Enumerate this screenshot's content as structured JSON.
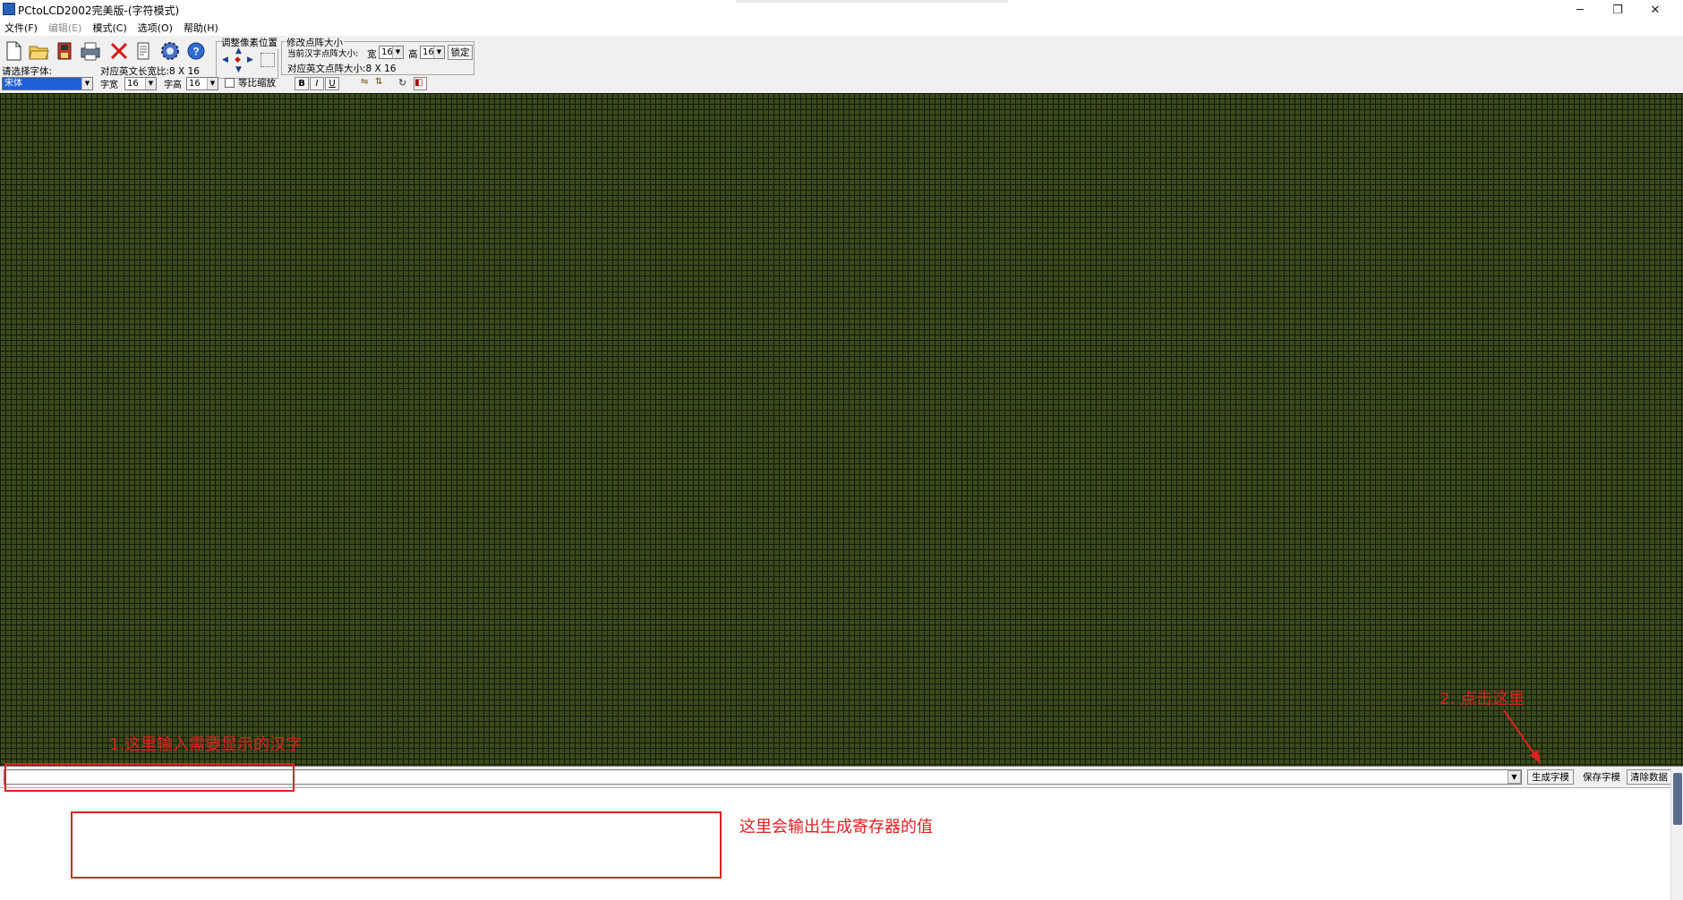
{
  "window": {
    "title": "PCtoLCD2002完美版-(字符模式)",
    "minimize": "─",
    "restore": "❐",
    "close": "✕"
  },
  "menu": [
    {
      "label": "文件(F)",
      "enabled": true
    },
    {
      "label": "编辑(E)",
      "enabled": false
    },
    {
      "label": "模式(C)",
      "enabled": true
    },
    {
      "label": "选项(O)",
      "enabled": true
    },
    {
      "label": "帮助(H)",
      "enabled": true
    }
  ],
  "toolbar": {
    "icons": [
      "new-file-icon",
      "open-folder-icon",
      "save-icon",
      "print-icon",
      "delete-icon",
      "properties-icon",
      "settings-gear-icon",
      "help-icon"
    ],
    "font_label": "请选择字体:",
    "font_value": "宋体",
    "en_ratio_label": "对应英文长宽比:8 X 16",
    "char_width_label": "字宽",
    "char_width_value": "16",
    "char_height_label": "字高",
    "char_height_value": "16",
    "proportional_label": "等比缩放",
    "bold": "B",
    "italic": "I",
    "underline": "U",
    "pixel_group_label": "调整像素位置",
    "matrix_group_label": "修改点阵大小",
    "current_matrix_label": "当前汉字点阵大小:",
    "width_label": "宽",
    "width_value": "16",
    "height_label": "高",
    "height_value": "16",
    "lock_label": "锁定",
    "en_matrix_label": "对应英文点阵大小:8 X 16"
  },
  "bottom": {
    "input_value": "",
    "generate_button": "生成字模",
    "save_button": "保存字模",
    "clear_button": "清除数据"
  },
  "annotations": {
    "step1": "1.这里输入需要显示的汉字",
    "step2": "2. 点击这里",
    "output_note": "这里会输出生成寄存器的值"
  },
  "colors": {
    "matrix_background": "#3a4a1c",
    "annotation_red": "#e02020"
  }
}
